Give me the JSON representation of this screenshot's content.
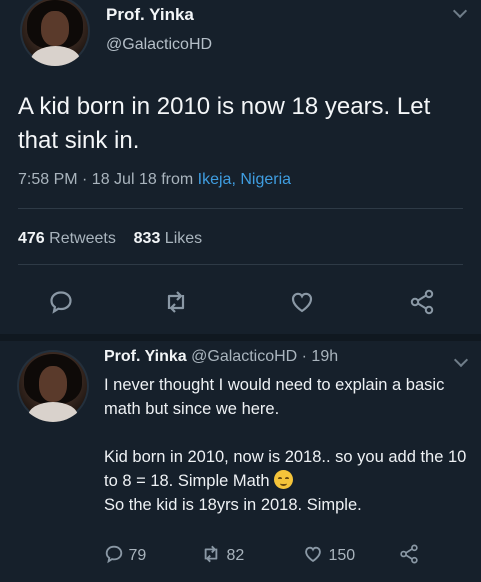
{
  "main_tweet": {
    "author_name": "Prof. Yinka",
    "handle": "@GalacticoHD",
    "text": "A kid born in 2010 is now 18 years. Let that sink in.",
    "time_date": "7:58 PM · 18 Jul 18 from ",
    "location": "Ikeja, Nigeria",
    "retweets_count": "476",
    "retweets_label": "Retweets",
    "likes_count": "833",
    "likes_label": "Likes",
    "actions": [
      "reply-icon",
      "retweet-icon",
      "like-icon",
      "share-icon"
    ]
  },
  "reply_tweet": {
    "author_name": "Prof. Yinka",
    "handle_time": "@GalacticoHD · 19h",
    "line1": "I never thought I would need to explain a basic math but since we here.",
    "line2": "Kid born in 2010, now is 2018.. so you add the 10 to 8 = 18. Simple Math",
    "line3": "So the kid is 18yrs in 2018. Simple.",
    "reply_count": "79",
    "retweet_count": "82",
    "like_count": "150"
  },
  "colors": {
    "background": "#16202b",
    "link_blue": "#3f9de0",
    "icon_gray": "#8a98a5"
  }
}
